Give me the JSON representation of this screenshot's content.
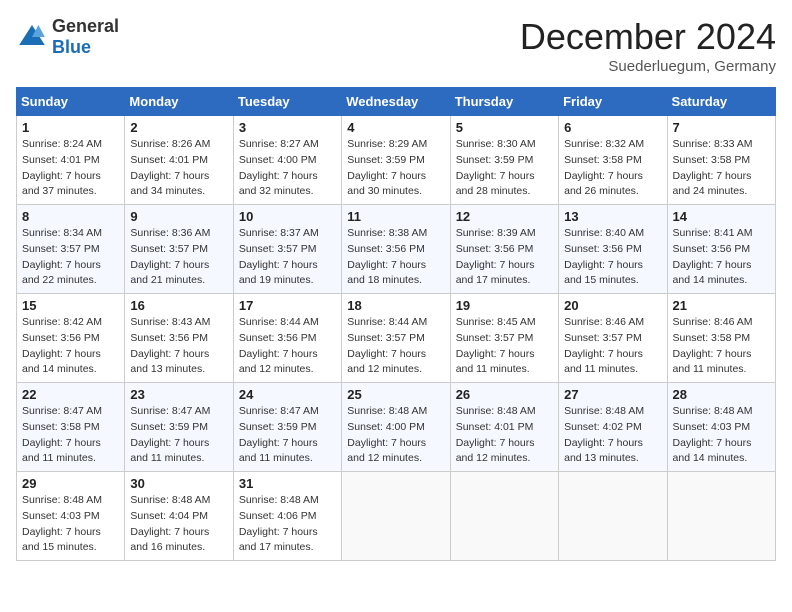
{
  "header": {
    "logo_general": "General",
    "logo_blue": "Blue",
    "title": "December 2024",
    "subtitle": "Suederluegum, Germany"
  },
  "days_of_week": [
    "Sunday",
    "Monday",
    "Tuesday",
    "Wednesday",
    "Thursday",
    "Friday",
    "Saturday"
  ],
  "weeks": [
    [
      {
        "day": "1",
        "sunrise": "8:24 AM",
        "sunset": "4:01 PM",
        "daylight": "7 hours and 37 minutes."
      },
      {
        "day": "2",
        "sunrise": "8:26 AM",
        "sunset": "4:01 PM",
        "daylight": "7 hours and 34 minutes."
      },
      {
        "day": "3",
        "sunrise": "8:27 AM",
        "sunset": "4:00 PM",
        "daylight": "7 hours and 32 minutes."
      },
      {
        "day": "4",
        "sunrise": "8:29 AM",
        "sunset": "3:59 PM",
        "daylight": "7 hours and 30 minutes."
      },
      {
        "day": "5",
        "sunrise": "8:30 AM",
        "sunset": "3:59 PM",
        "daylight": "7 hours and 28 minutes."
      },
      {
        "day": "6",
        "sunrise": "8:32 AM",
        "sunset": "3:58 PM",
        "daylight": "7 hours and 26 minutes."
      },
      {
        "day": "7",
        "sunrise": "8:33 AM",
        "sunset": "3:58 PM",
        "daylight": "7 hours and 24 minutes."
      }
    ],
    [
      {
        "day": "8",
        "sunrise": "8:34 AM",
        "sunset": "3:57 PM",
        "daylight": "7 hours and 22 minutes."
      },
      {
        "day": "9",
        "sunrise": "8:36 AM",
        "sunset": "3:57 PM",
        "daylight": "7 hours and 21 minutes."
      },
      {
        "day": "10",
        "sunrise": "8:37 AM",
        "sunset": "3:57 PM",
        "daylight": "7 hours and 19 minutes."
      },
      {
        "day": "11",
        "sunrise": "8:38 AM",
        "sunset": "3:56 PM",
        "daylight": "7 hours and 18 minutes."
      },
      {
        "day": "12",
        "sunrise": "8:39 AM",
        "sunset": "3:56 PM",
        "daylight": "7 hours and 17 minutes."
      },
      {
        "day": "13",
        "sunrise": "8:40 AM",
        "sunset": "3:56 PM",
        "daylight": "7 hours and 15 minutes."
      },
      {
        "day": "14",
        "sunrise": "8:41 AM",
        "sunset": "3:56 PM",
        "daylight": "7 hours and 14 minutes."
      }
    ],
    [
      {
        "day": "15",
        "sunrise": "8:42 AM",
        "sunset": "3:56 PM",
        "daylight": "7 hours and 14 minutes."
      },
      {
        "day": "16",
        "sunrise": "8:43 AM",
        "sunset": "3:56 PM",
        "daylight": "7 hours and 13 minutes."
      },
      {
        "day": "17",
        "sunrise": "8:44 AM",
        "sunset": "3:56 PM",
        "daylight": "7 hours and 12 minutes."
      },
      {
        "day": "18",
        "sunrise": "8:44 AM",
        "sunset": "3:57 PM",
        "daylight": "7 hours and 12 minutes."
      },
      {
        "day": "19",
        "sunrise": "8:45 AM",
        "sunset": "3:57 PM",
        "daylight": "7 hours and 11 minutes."
      },
      {
        "day": "20",
        "sunrise": "8:46 AM",
        "sunset": "3:57 PM",
        "daylight": "7 hours and 11 minutes."
      },
      {
        "day": "21",
        "sunrise": "8:46 AM",
        "sunset": "3:58 PM",
        "daylight": "7 hours and 11 minutes."
      }
    ],
    [
      {
        "day": "22",
        "sunrise": "8:47 AM",
        "sunset": "3:58 PM",
        "daylight": "7 hours and 11 minutes."
      },
      {
        "day": "23",
        "sunrise": "8:47 AM",
        "sunset": "3:59 PM",
        "daylight": "7 hours and 11 minutes."
      },
      {
        "day": "24",
        "sunrise": "8:47 AM",
        "sunset": "3:59 PM",
        "daylight": "7 hours and 11 minutes."
      },
      {
        "day": "25",
        "sunrise": "8:48 AM",
        "sunset": "4:00 PM",
        "daylight": "7 hours and 12 minutes."
      },
      {
        "day": "26",
        "sunrise": "8:48 AM",
        "sunset": "4:01 PM",
        "daylight": "7 hours and 12 minutes."
      },
      {
        "day": "27",
        "sunrise": "8:48 AM",
        "sunset": "4:02 PM",
        "daylight": "7 hours and 13 minutes."
      },
      {
        "day": "28",
        "sunrise": "8:48 AM",
        "sunset": "4:03 PM",
        "daylight": "7 hours and 14 minutes."
      }
    ],
    [
      {
        "day": "29",
        "sunrise": "8:48 AM",
        "sunset": "4:03 PM",
        "daylight": "7 hours and 15 minutes."
      },
      {
        "day": "30",
        "sunrise": "8:48 AM",
        "sunset": "4:04 PM",
        "daylight": "7 hours and 16 minutes."
      },
      {
        "day": "31",
        "sunrise": "8:48 AM",
        "sunset": "4:06 PM",
        "daylight": "7 hours and 17 minutes."
      },
      null,
      null,
      null,
      null
    ]
  ]
}
